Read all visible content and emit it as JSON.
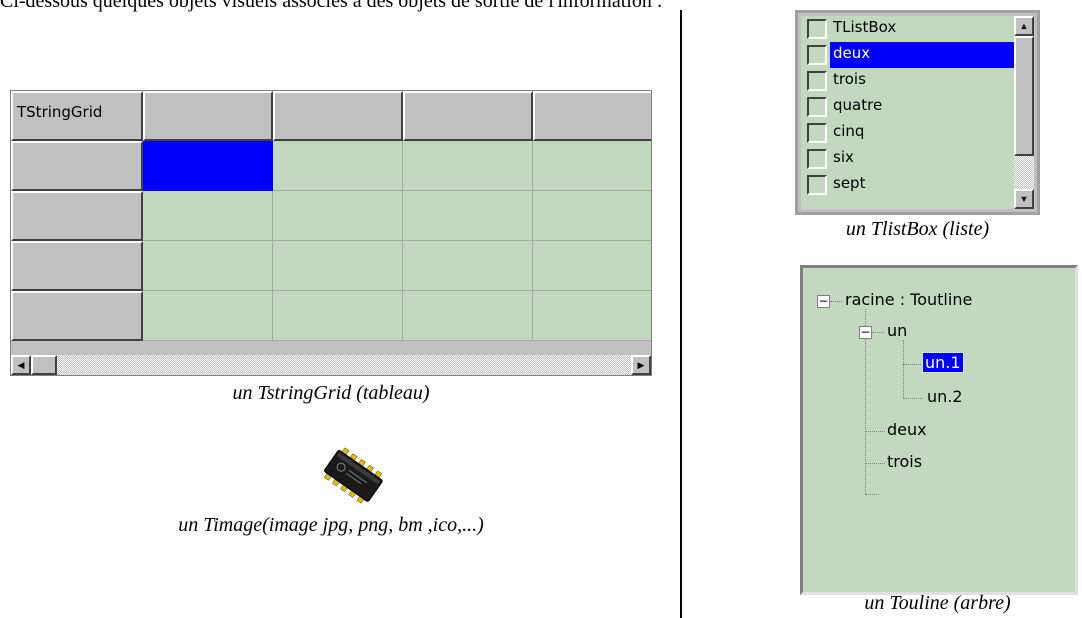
{
  "intro_text": "Ci-dessous quelques objets visuels associés à des objets de sortie de l'information :",
  "string_grid": {
    "header": "TStringGrid",
    "caption": "un TstringGrid (tableau)"
  },
  "listbox": {
    "items": [
      "TListBox",
      "deux",
      "trois",
      "quatre",
      "cinq",
      "six",
      "sept"
    ],
    "selected_index": 1,
    "caption": "un TlistBox (liste)"
  },
  "image": {
    "icon": "chip-icon",
    "caption": "un Timage(image jpg, png, bm ,ico,...)"
  },
  "outline": {
    "root": "racine : Toutline",
    "child_un": "un",
    "child_un1": "un.1",
    "child_un2": "un.2",
    "child_deux": "deux",
    "child_trois": "trois",
    "caption": "un Touline (arbre)"
  },
  "colors": {
    "grid_bg": "#c2d9bf",
    "selection": "#0000ff"
  }
}
